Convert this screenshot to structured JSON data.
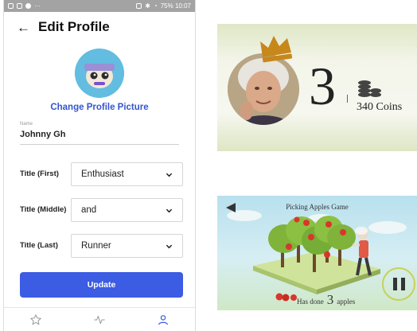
{
  "status_bar": {
    "right_text": "75% 10:07"
  },
  "header": {
    "title": "Edit Profile"
  },
  "profile": {
    "change_picture_label": "Change Profile Picture",
    "name_label": "Name",
    "name_value": "Johnny Gh"
  },
  "titles": [
    {
      "label": "Title (First)",
      "value": "Enthusiast"
    },
    {
      "label": "Title (Middle)",
      "value": "and"
    },
    {
      "label": "Title (Last)",
      "value": "Runner"
    }
  ],
  "update_label": "Update",
  "tabs": [
    {
      "icon": "star-icon"
    },
    {
      "icon": "activity-icon"
    },
    {
      "icon": "person-icon"
    }
  ],
  "colors": {
    "accent": "#3b5ce3",
    "link": "#3456cf",
    "active_tab": "#3b5ce3"
  },
  "leaderboard_card": {
    "rank": "3",
    "coins": "340 Coins"
  },
  "game_card": {
    "title": "Picking Apples Game",
    "status_prefix": "Has done",
    "apples_count": "3",
    "status_suffix": "apples"
  }
}
